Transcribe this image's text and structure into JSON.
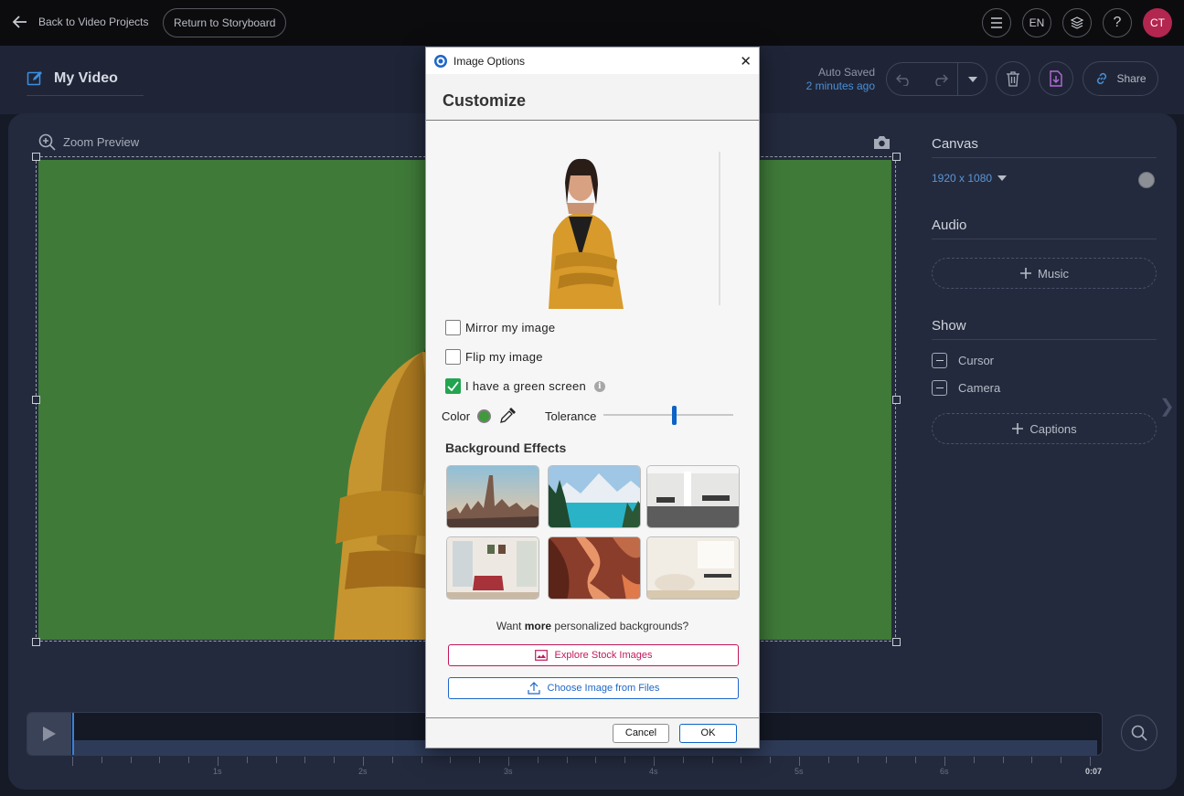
{
  "topbar": {
    "back_label": "Back to Video Projects",
    "storyboard_label": "Return to Storyboard",
    "lang": "EN",
    "help": "?",
    "avatar_initials": "CT"
  },
  "project": {
    "title": "My Video",
    "autosave_line1": "Auto Saved",
    "autosave_line2": "2 minutes ago",
    "share_label": "Share"
  },
  "preview": {
    "zoom_label": "Zoom Preview",
    "background_color": "#3f7a39"
  },
  "right_panel": {
    "canvas_heading": "Canvas",
    "resolution": "1920 x 1080",
    "audio_heading": "Audio",
    "music_label": "Music",
    "show_heading": "Show",
    "cursor_label": "Cursor",
    "camera_label": "Camera",
    "captions_label": "Captions"
  },
  "timeline": {
    "labels": [
      "1s",
      "2s",
      "3s",
      "4s",
      "5s",
      "6s"
    ],
    "end_label": "0:07"
  },
  "dialog": {
    "window_title": "Image Options",
    "heading": "Customize",
    "mirror_label": "Mirror my image",
    "mirror_checked": false,
    "flip_label": "Flip my image",
    "flip_checked": false,
    "greenscreen_label": "I have a green screen",
    "greenscreen_checked": true,
    "color_label": "Color",
    "key_color": "#3f9a3a",
    "tolerance_label": "Tolerance",
    "tolerance_value": 0.55,
    "bg_effects_heading": "Background Effects",
    "thumbnails": [
      "city-skyline",
      "mountain-lake",
      "office-interior",
      "living-room",
      "canyon",
      "lounge"
    ],
    "want_prefix": "Want ",
    "want_bold": "more",
    "want_suffix": " personalized backgrounds?",
    "stock_label": "Explore Stock Images",
    "files_label": "Choose Image from Files",
    "cancel_label": "Cancel",
    "ok_label": "OK"
  }
}
